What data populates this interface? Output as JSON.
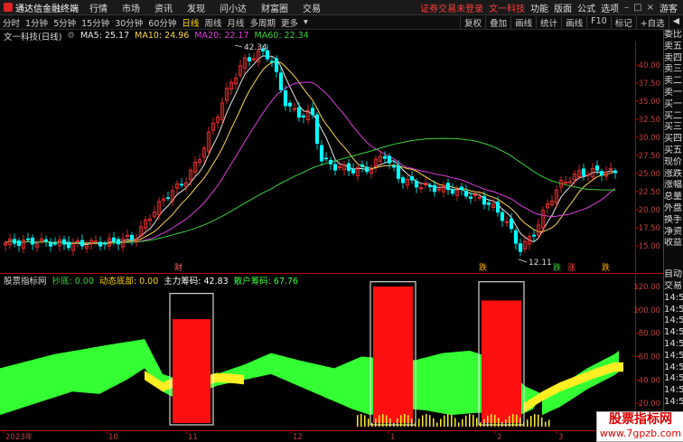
{
  "menubar": {
    "app_name": "通达信金融终端",
    "menus": [
      "行情",
      "市场",
      "资讯",
      "发现",
      "问小达",
      "财富圈",
      "交易"
    ],
    "notice": "证券交易未登录",
    "stock_name": "文一科技",
    "right_items": [
      "功能",
      "版面",
      "公式",
      "选项"
    ],
    "user": "游客"
  },
  "toolbar": {
    "timeframes": [
      "分时",
      "1分钟",
      "5分钟",
      "15分钟",
      "30分钟",
      "60分钟",
      "日线",
      "周线",
      "月线",
      "多周期",
      "更多"
    ],
    "active": "日线",
    "right_buttons": [
      "复权",
      "叠加",
      "画线",
      "统计",
      "画线",
      "F10",
      "标记",
      "+自选",
      "◀"
    ]
  },
  "chart_title": {
    "name": "文一科技(日线)",
    "ma5": "MA5: 25.17",
    "ma10": "MA10: 24.96",
    "ma20": "MA20: 22.17",
    "ma60": "MA60: 22.34"
  },
  "right_panel": {
    "items": [
      "委比",
      "卖五",
      "卖四",
      "卖三",
      "卖二",
      "卖一",
      "买一",
      "买二",
      "买三",
      "买四",
      "买五",
      "现价",
      "涨跌",
      "涨幅",
      "总量",
      "外盘",
      "换手",
      "净资",
      "收益"
    ],
    "lower_items": [
      "自动",
      "交易",
      "14:5",
      "14:5",
      "14:5",
      "14:5",
      "14:5",
      "14:5",
      "14:5",
      "14:5",
      "14:5",
      "14:5"
    ]
  },
  "indicator_title": {
    "name": "股票指标网",
    "a": "抄底: 0.00",
    "b": "动态底部: 0.00",
    "c": "主力筹码: 42.83",
    "d": "散户筹码: 67.76"
  },
  "xaxis": {
    "labels": [
      "2023年",
      "10",
      "11",
      "12",
      "1",
      "2",
      "3"
    ]
  },
  "annotations": {
    "high": "42.34",
    "low": "12.11",
    "marks": [
      "财",
      "跌",
      "跌",
      "涨",
      "跌"
    ]
  },
  "yaxis_main": [
    "40.00",
    "37.50",
    "35.00",
    "32.50",
    "30.00",
    "27.50",
    "25.00",
    "22.50",
    "20.00",
    "17.50",
    "15.00"
  ],
  "yaxis_ind": [
    "120.00",
    "100.00",
    "80.00",
    "60.00",
    "40.00",
    "20.00"
  ],
  "watermark": {
    "line1": "股票指标网",
    "line2": "www.7gpzb.com"
  },
  "colors": {
    "up": "#ff3232",
    "down": "#00ffff",
    "ma5": "#e8e8e8",
    "ma10": "#ffd84a",
    "ma20": "#e040e0",
    "ma60": "#3cd23c",
    "green_band": "#33ff33",
    "yellow_band": "#ffee22",
    "red_box": "#ff1010"
  }
}
